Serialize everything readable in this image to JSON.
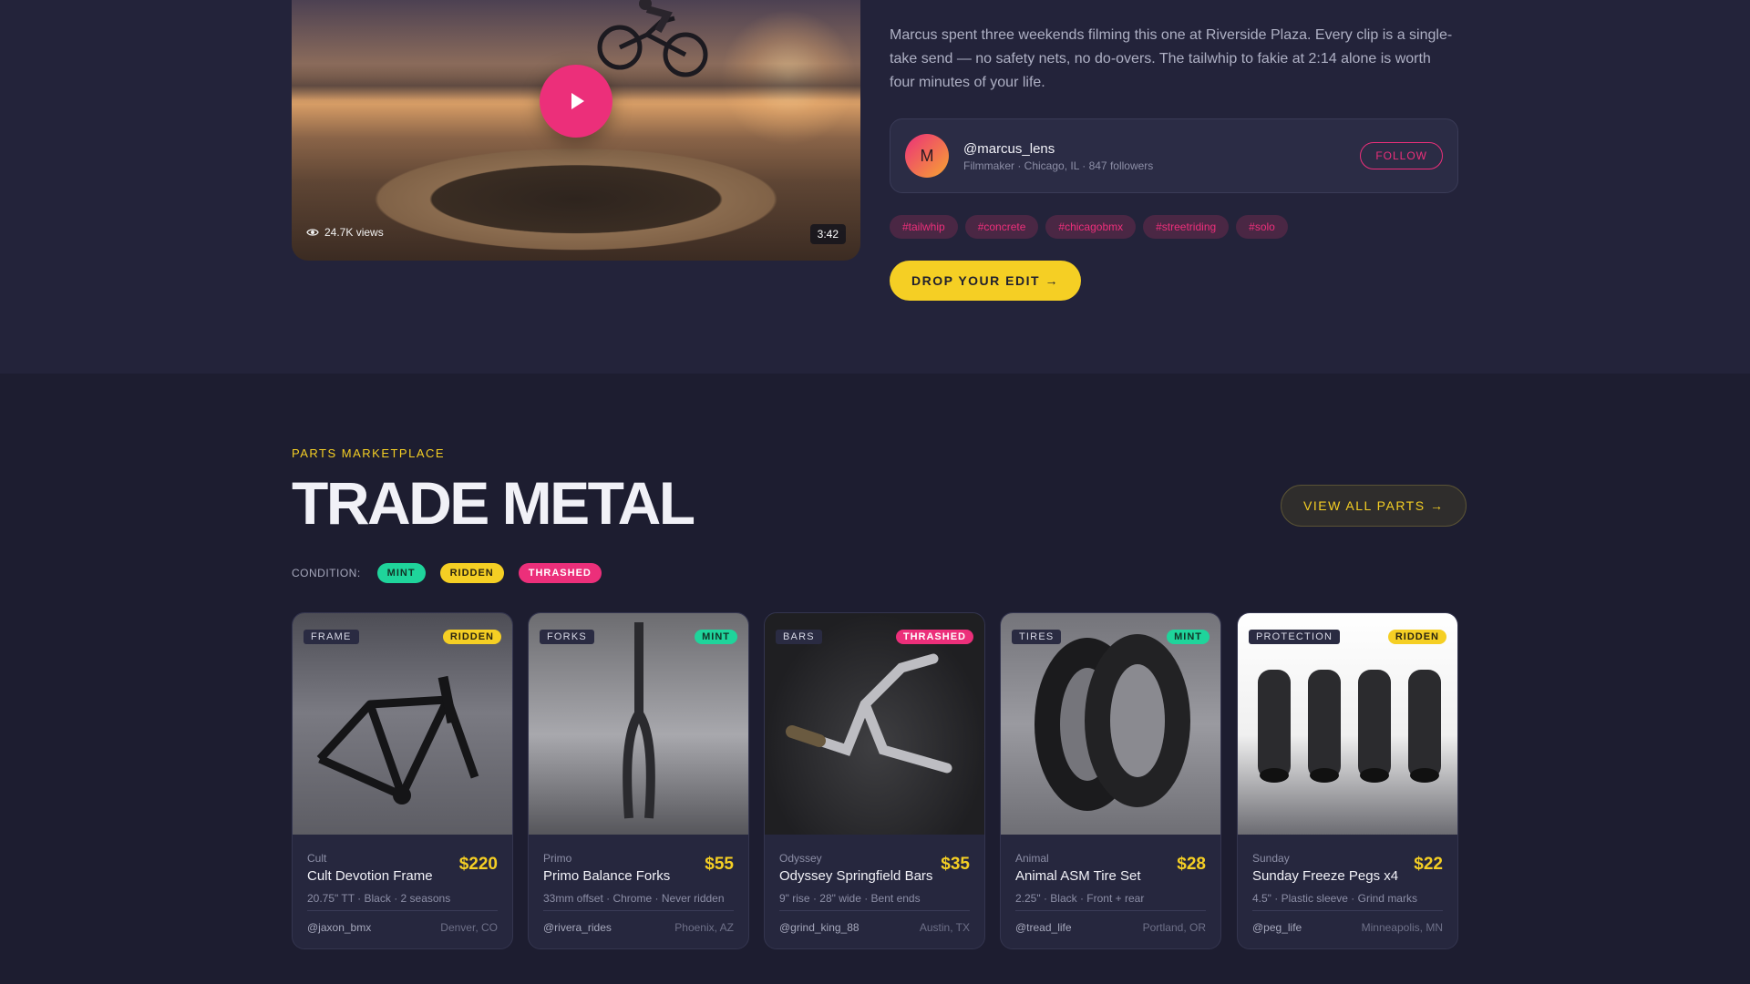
{
  "feature": {
    "views": "24.7K views",
    "duration": "3:42",
    "description": "Marcus spent three weekends filming this one at Riverside Plaza. Every clip is a single-take send — no safety nets, no do-overs. The tailwhip to fakie at 2:14 alone is worth four minutes of your life.",
    "creator": {
      "initial": "M",
      "handle": "@marcus_lens",
      "meta": "Filmmaker · Chicago, IL · 847 followers",
      "follow_label": "FOLLOW"
    },
    "tags": [
      "#tailwhip",
      "#concrete",
      "#chicagobmx",
      "#streetriding",
      "#solo"
    ],
    "cta_label": "DROP YOUR EDIT →"
  },
  "marketplace": {
    "eyebrow": "PARTS MARKETPLACE",
    "title": "TRADE METAL",
    "view_all_label": "VIEW ALL PARTS →",
    "condition_label": "CONDITION:",
    "conditions": [
      "MINT",
      "RIDDEN",
      "THRASHED"
    ],
    "items": [
      {
        "category": "FRAME",
        "condition": "RIDDEN",
        "brand": "Cult",
        "name": "Cult Devotion Frame",
        "price": "$220",
        "specs": "20.75\" TT · Black · 2 seasons",
        "seller": "@jaxon_bmx",
        "location": "Denver, CO"
      },
      {
        "category": "FORKS",
        "condition": "MINT",
        "brand": "Primo",
        "name": "Primo Balance Forks",
        "price": "$55",
        "specs": "33mm offset · Chrome · Never ridden",
        "seller": "@rivera_rides",
        "location": "Phoenix, AZ"
      },
      {
        "category": "BARS",
        "condition": "THRASHED",
        "brand": "Odyssey",
        "name": "Odyssey Springfield Bars",
        "price": "$35",
        "specs": "9\" rise · 28\" wide · Bent ends",
        "seller": "@grind_king_88",
        "location": "Austin, TX"
      },
      {
        "category": "TIRES",
        "condition": "MINT",
        "brand": "Animal",
        "name": "Animal ASM Tire Set",
        "price": "$28",
        "specs": "2.25\" · Black · Front + rear",
        "seller": "@tread_life",
        "location": "Portland, OR"
      },
      {
        "category": "PROTECTION",
        "condition": "RIDDEN",
        "brand": "Sunday",
        "name": "Sunday Freeze Pegs x4",
        "price": "$22",
        "specs": "4.5\" · Plastic sleeve · Grind marks",
        "seller": "@peg_life",
        "location": "Minneapolis, MN"
      }
    ]
  },
  "colors": {
    "accent_pink": "#ec2f7a",
    "accent_yellow": "#f5cf24",
    "accent_mint": "#1fd49b",
    "bg_top": "#23233a",
    "bg_market": "#1d1d30"
  }
}
